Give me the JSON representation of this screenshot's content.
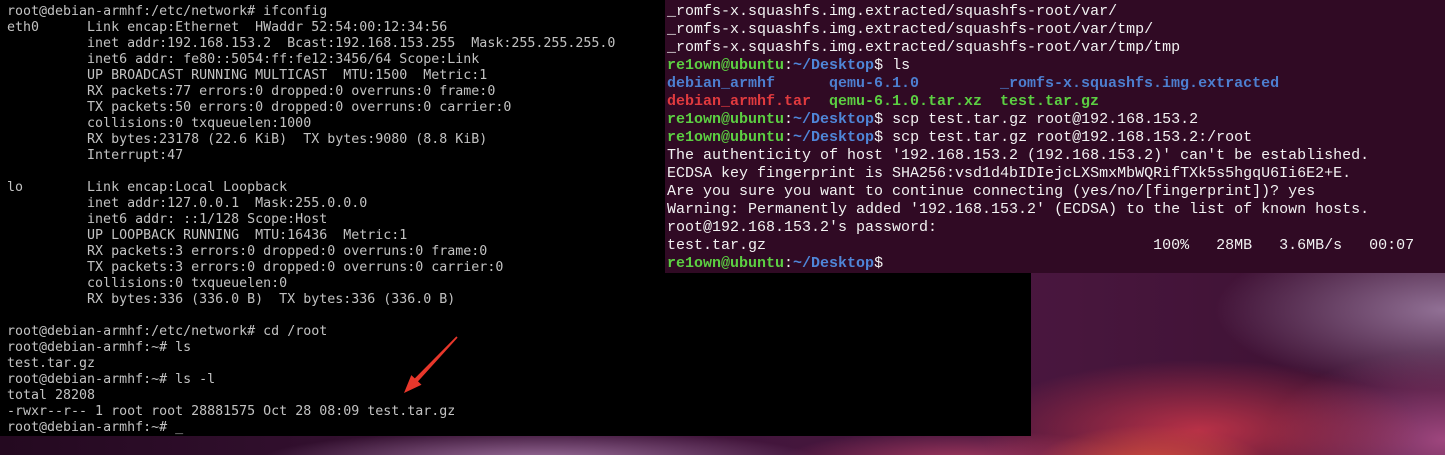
{
  "qemu_console": {
    "colors": {
      "background": "#000000",
      "text": "#c2c2c2"
    },
    "commands": [
      {
        "prompt": "root@debian-armhf:/etc/network#",
        "input": "ifconfig"
      },
      {
        "prompt": "root@debian-armhf:/etc/network#",
        "input": "cd /root"
      },
      {
        "prompt": "root@debian-armhf:~#",
        "input": "ls"
      },
      {
        "prompt": "root@debian-armhf:~#",
        "input": "ls -l"
      },
      {
        "prompt": "root@debian-armhf:~#"
      }
    ],
    "ifconfig_output": [
      {
        "iface": "eth0",
        "lines": [
          "Link encap:Ethernet  HWaddr 52:54:00:12:34:56",
          "inet addr:192.168.153.2  Bcast:192.168.153.255  Mask:255.255.255.0",
          "inet6 addr: fe80::5054:ff:fe12:3456/64 Scope:Link",
          "UP BROADCAST RUNNING MULTICAST  MTU:1500  Metric:1",
          "RX packets:77 errors:0 dropped:0 overruns:0 frame:0",
          "TX packets:50 errors:0 dropped:0 overruns:0 carrier:0",
          "collisions:0 txqueuelen:1000",
          "RX bytes:23178 (22.6 KiB)  TX bytes:9080 (8.8 KiB)",
          "Interrupt:47"
        ]
      },
      {
        "iface": "lo",
        "lines": [
          "Link encap:Local Loopback",
          "inet addr:127.0.0.1  Mask:255.0.0.0",
          "inet6 addr: ::1/128 Scope:Host",
          "UP LOOPBACK RUNNING  MTU:16436  Metric:1",
          "RX packets:3 errors:0 dropped:0 overruns:0 frame:0",
          "TX packets:3 errors:0 dropped:0 overruns:0 carrier:0",
          "collisions:0 txqueuelen:0",
          "RX bytes:336 (336.0 B)  TX bytes:336 (336.0 B)"
        ]
      }
    ],
    "ls_output": [
      "test.tar.gz"
    ],
    "ls_l_output": [
      "total 28208",
      "-rwxr--r-- 1 root root 28881575 Oct 28 08:09 test.tar.gz"
    ],
    "cursor": "_"
  },
  "ubuntu_terminal": {
    "colors": {
      "background": "#300a24",
      "text": "#f2f2f2",
      "prompt_user": "#5ccf42",
      "prompt_path": "#4f86d8",
      "directory": "#4d7fd0",
      "archive": "#e03a3e",
      "executable": "#5ccf42"
    },
    "scrollback": [
      "_romfs-x.squashfs.img.extracted/squashfs-root/var/",
      "_romfs-x.squashfs.img.extracted/squashfs-root/var/tmp/",
      "_romfs-x.squashfs.img.extracted/squashfs-root/var/tmp/tmp"
    ],
    "prompt": {
      "user_host": "re1own@ubuntu",
      "separator": ":",
      "path": "~/Desktop",
      "symbol": "$"
    },
    "commands": [
      "ls",
      "scp test.tar.gz root@192.168.153.2",
      "scp test.tar.gz root@192.168.153.2:/root"
    ],
    "ls_listing": [
      [
        "debian_armhf",
        "qemu-6.1.0",
        "_romfs-x.squashfs.img.extracted"
      ],
      [
        "debian_armhf.tar",
        "qemu-6.1.0.tar.xz",
        "test.tar.gz"
      ]
    ],
    "scp_messages": [
      "The authenticity of host '192.168.153.2 (192.168.153.2)' can't be established.",
      "ECDSA key fingerprint is SHA256:vsd1d4bIDIejcLXSmxMbWQRifTXk5s5hgqU6Ii6E2+E.",
      "Are you sure you want to continue connecting (yes/no/[fingerprint])? yes",
      "Warning: Permanently added '192.168.153.2' (ECDSA) to the list of known hosts.",
      "root@192.168.153.2's password:"
    ],
    "transfer": {
      "file": "test.tar.gz",
      "percent": "100%",
      "size": "28MB",
      "rate": "3.6MB/s",
      "elapsed": "00:07"
    }
  },
  "annotation": {
    "arrow_color": "#e8372b"
  }
}
